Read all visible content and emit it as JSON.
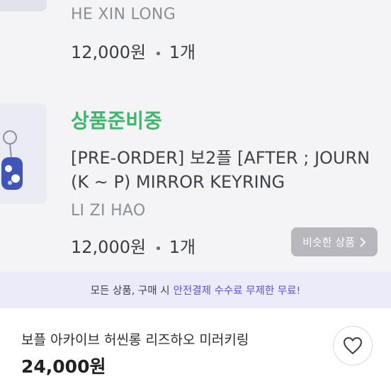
{
  "order_items": [
    {
      "seller": "HE XIN LONG",
      "price": "12,000원",
      "quantity": "1개"
    },
    {
      "status": "상품준비중",
      "title_line1": "[PRE-ORDER] 보2플 [AFTER ; JOURN",
      "title_line2": "(K ~ P) MIRROR KEYRING",
      "seller": "LI ZI HAO",
      "price": "12,000원",
      "quantity": "1개",
      "similar_button": "비슷한 상품"
    }
  ],
  "banner": {
    "text": "모든 상품, 구매 시",
    "highlight": "안전결제 수수료 무제한 무료!"
  },
  "product": {
    "name": "보플 아카이브 허씬롱 리즈하오 미러키링",
    "price": "24,000원"
  },
  "colors": {
    "status_green": "#3cb86a",
    "highlight_purple": "#5a4fe0",
    "banner_bg": "#ecebfa"
  },
  "icons": [
    "chevron-right-icon",
    "heart-icon"
  ]
}
